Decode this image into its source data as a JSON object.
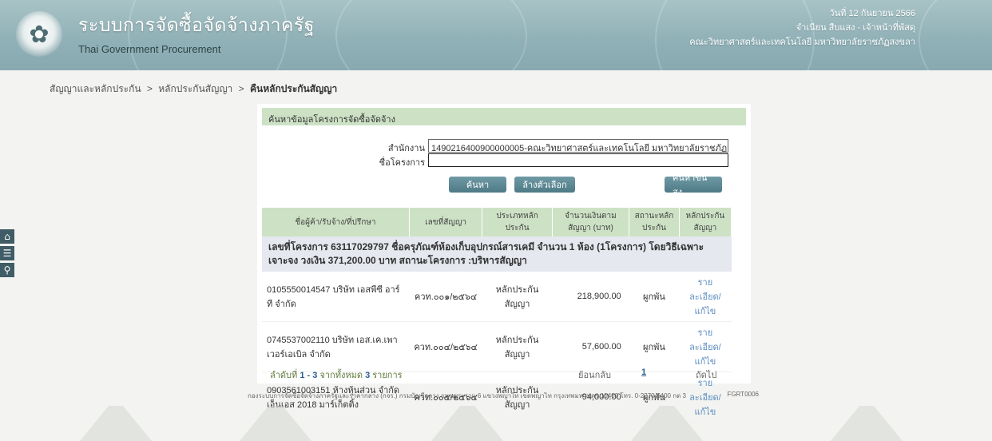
{
  "header": {
    "title": "ระบบการจัดซื้อจัดจ้างภาครัฐ",
    "subtitle": "Thai Government Procurement",
    "date": "วันที่ 12 กันยายน 2566",
    "user": "จำเนียน สืบแสง - เจ้าหน้าที่พัสดุ",
    "org": "คณะวิทยาศาสตร์และเทคโนโลยี มหาวิทยาลัยราชภัฏสงขลา"
  },
  "breadcrumb": {
    "item1": "สัญญาและหลักประกัน",
    "sep": ">",
    "item2": "หลักประกันสัญญา",
    "current": "คืนหลักประกันสัญญา"
  },
  "sidebar": {
    "home_icon": "home-icon",
    "menu_icon": "menu-icon",
    "search_icon": "search-icon"
  },
  "panel": {
    "title": "ค้นหาข้อมูลโครงการจัดซื้อจัดจ้าง",
    "agency_label": "สำนักงาน",
    "agency_value": "1490216400900000005-คณะวิทยาศาสตร์และเทคโนโลยี มหาวิทยาลัยราชภัฏสงขลา",
    "project_label": "ชื่อโครงการ",
    "project_value": "",
    "search_button": "ค้นหา",
    "clear_button": "ล้างตัวเลือก",
    "advanced_button": "ค้นหาขั้นสูง"
  },
  "table": {
    "headers": [
      "ชื่อผู้ค้า/รับจ้าง/ที่ปรึกษา",
      "เลขที่สัญญา",
      "ประเภทหลักประกัน",
      "จำนวนเงินตามสัญญา (บาท)",
      "สถานะหลักประกัน",
      "หลักประกันสัญญา"
    ],
    "project_line": "เลขที่โครงการ 63117029797 ชื่อครุภัณฑ์ห้องเก็บอุปกรณ์สารเคมี จำนวน 1 ห้อง (1โครงการ) โดยวิธีเฉพาะเจาะจง วงเงิน 371,200.00 บาท สถานะโครงการ :บริหารสัญญา",
    "rows": [
      {
        "vendor": "0105550014547 บริษัท เอสพีซี อาร์ที จำกัด",
        "contract": "ควท.๐๐๑/๒๕๖๔",
        "type": "หลักประกันสัญญา",
        "amount": "218,900.00",
        "status": "ผูกพัน",
        "action": "รายละเอียด/แก้ไข"
      },
      {
        "vendor": "0745537002110 บริษัท เอส.เค.เพาเวอร์เอเบิล จำกัด",
        "contract": "ควท.๐๐๔/๒๕๖๔",
        "type": "หลักประกันสัญญา",
        "amount": "57,600.00",
        "status": "ผูกพัน",
        "action": "รายละเอียด/แก้ไข"
      },
      {
        "vendor": "0903561003151 ห้างหุ้นส่วน จำกัด เอ็นเอส 2018 มาร์เก็ตติ้ง",
        "contract": "ควท.๐๐๕/๒๕๖๔",
        "type": "หลักประกันสัญญา",
        "amount": "94,000.00",
        "status": "ผูกพัน",
        "action": "รายละเอียด/แก้ไข"
      }
    ]
  },
  "pager": {
    "summary_prefix": "ลำดับที่",
    "range": "1 - 3",
    "summary_mid": "จากทั้งหมด",
    "total": "3",
    "summary_suffix": "รายการ",
    "prev": "ย้อนกลับ",
    "page": "1",
    "next": "ถัดไป"
  },
  "footer": {
    "text": "กองระบบการจัดซื้อจัดจ้างภาครัฐและราคากลาง (กจร.) กรมบัญชีกลาง ถนนพระราม 6 แขวงพญาไท เขตพญาไท กรุงเทพมหานคร 10400 โทร. 0-2270-6400 กด 3",
    "code": "FGRT0006"
  }
}
